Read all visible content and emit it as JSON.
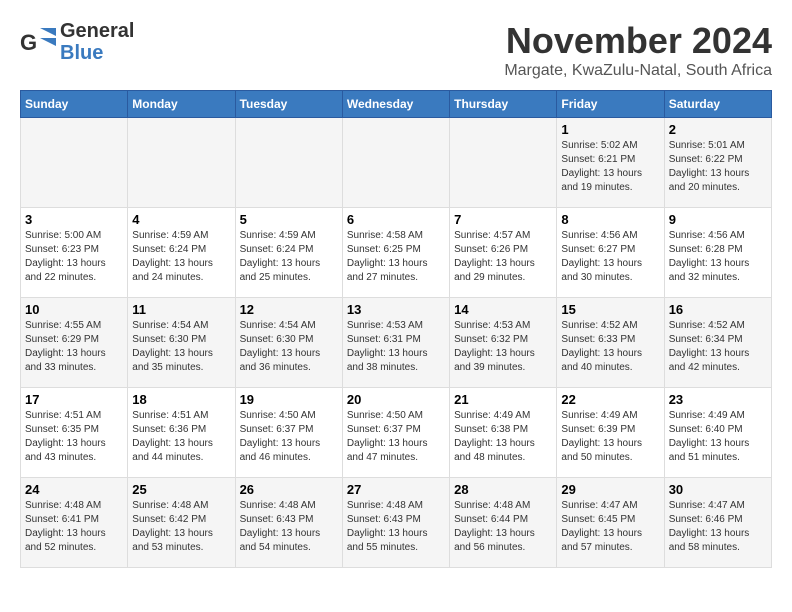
{
  "logo": {
    "general": "General",
    "blue": "Blue"
  },
  "title": "November 2024",
  "subtitle": "Margate, KwaZulu-Natal, South Africa",
  "headers": [
    "Sunday",
    "Monday",
    "Tuesday",
    "Wednesday",
    "Thursday",
    "Friday",
    "Saturday"
  ],
  "weeks": [
    [
      {
        "day": "",
        "content": ""
      },
      {
        "day": "",
        "content": ""
      },
      {
        "day": "",
        "content": ""
      },
      {
        "day": "",
        "content": ""
      },
      {
        "day": "",
        "content": ""
      },
      {
        "day": "1",
        "content": "Sunrise: 5:02 AM\nSunset: 6:21 PM\nDaylight: 13 hours and 19 minutes."
      },
      {
        "day": "2",
        "content": "Sunrise: 5:01 AM\nSunset: 6:22 PM\nDaylight: 13 hours and 20 minutes."
      }
    ],
    [
      {
        "day": "3",
        "content": "Sunrise: 5:00 AM\nSunset: 6:23 PM\nDaylight: 13 hours and 22 minutes."
      },
      {
        "day": "4",
        "content": "Sunrise: 4:59 AM\nSunset: 6:24 PM\nDaylight: 13 hours and 24 minutes."
      },
      {
        "day": "5",
        "content": "Sunrise: 4:59 AM\nSunset: 6:24 PM\nDaylight: 13 hours and 25 minutes."
      },
      {
        "day": "6",
        "content": "Sunrise: 4:58 AM\nSunset: 6:25 PM\nDaylight: 13 hours and 27 minutes."
      },
      {
        "day": "7",
        "content": "Sunrise: 4:57 AM\nSunset: 6:26 PM\nDaylight: 13 hours and 29 minutes."
      },
      {
        "day": "8",
        "content": "Sunrise: 4:56 AM\nSunset: 6:27 PM\nDaylight: 13 hours and 30 minutes."
      },
      {
        "day": "9",
        "content": "Sunrise: 4:56 AM\nSunset: 6:28 PM\nDaylight: 13 hours and 32 minutes."
      }
    ],
    [
      {
        "day": "10",
        "content": "Sunrise: 4:55 AM\nSunset: 6:29 PM\nDaylight: 13 hours and 33 minutes."
      },
      {
        "day": "11",
        "content": "Sunrise: 4:54 AM\nSunset: 6:30 PM\nDaylight: 13 hours and 35 minutes."
      },
      {
        "day": "12",
        "content": "Sunrise: 4:54 AM\nSunset: 6:30 PM\nDaylight: 13 hours and 36 minutes."
      },
      {
        "day": "13",
        "content": "Sunrise: 4:53 AM\nSunset: 6:31 PM\nDaylight: 13 hours and 38 minutes."
      },
      {
        "day": "14",
        "content": "Sunrise: 4:53 AM\nSunset: 6:32 PM\nDaylight: 13 hours and 39 minutes."
      },
      {
        "day": "15",
        "content": "Sunrise: 4:52 AM\nSunset: 6:33 PM\nDaylight: 13 hours and 40 minutes."
      },
      {
        "day": "16",
        "content": "Sunrise: 4:52 AM\nSunset: 6:34 PM\nDaylight: 13 hours and 42 minutes."
      }
    ],
    [
      {
        "day": "17",
        "content": "Sunrise: 4:51 AM\nSunset: 6:35 PM\nDaylight: 13 hours and 43 minutes."
      },
      {
        "day": "18",
        "content": "Sunrise: 4:51 AM\nSunset: 6:36 PM\nDaylight: 13 hours and 44 minutes."
      },
      {
        "day": "19",
        "content": "Sunrise: 4:50 AM\nSunset: 6:37 PM\nDaylight: 13 hours and 46 minutes."
      },
      {
        "day": "20",
        "content": "Sunrise: 4:50 AM\nSunset: 6:37 PM\nDaylight: 13 hours and 47 minutes."
      },
      {
        "day": "21",
        "content": "Sunrise: 4:49 AM\nSunset: 6:38 PM\nDaylight: 13 hours and 48 minutes."
      },
      {
        "day": "22",
        "content": "Sunrise: 4:49 AM\nSunset: 6:39 PM\nDaylight: 13 hours and 50 minutes."
      },
      {
        "day": "23",
        "content": "Sunrise: 4:49 AM\nSunset: 6:40 PM\nDaylight: 13 hours and 51 minutes."
      }
    ],
    [
      {
        "day": "24",
        "content": "Sunrise: 4:48 AM\nSunset: 6:41 PM\nDaylight: 13 hours and 52 minutes."
      },
      {
        "day": "25",
        "content": "Sunrise: 4:48 AM\nSunset: 6:42 PM\nDaylight: 13 hours and 53 minutes."
      },
      {
        "day": "26",
        "content": "Sunrise: 4:48 AM\nSunset: 6:43 PM\nDaylight: 13 hours and 54 minutes."
      },
      {
        "day": "27",
        "content": "Sunrise: 4:48 AM\nSunset: 6:43 PM\nDaylight: 13 hours and 55 minutes."
      },
      {
        "day": "28",
        "content": "Sunrise: 4:48 AM\nSunset: 6:44 PM\nDaylight: 13 hours and 56 minutes."
      },
      {
        "day": "29",
        "content": "Sunrise: 4:47 AM\nSunset: 6:45 PM\nDaylight: 13 hours and 57 minutes."
      },
      {
        "day": "30",
        "content": "Sunrise: 4:47 AM\nSunset: 6:46 PM\nDaylight: 13 hours and 58 minutes."
      }
    ]
  ]
}
